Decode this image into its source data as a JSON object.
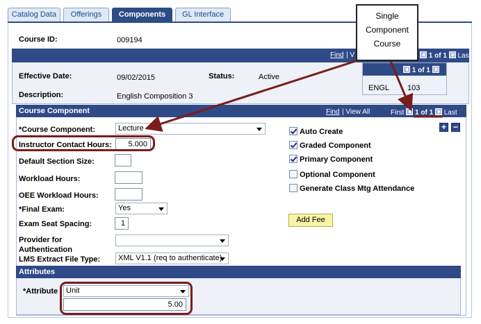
{
  "tabs": [
    {
      "label": "Catalog Data",
      "active": false
    },
    {
      "label": "Offerings",
      "active": false
    },
    {
      "label": "Components",
      "active": true
    },
    {
      "label": "GL Interface",
      "active": false
    }
  ],
  "course": {
    "id_label": "Course ID:",
    "id_value": "009194",
    "nav_find": "Find",
    "nav_view": "V",
    "nav_pos": "1 of 1",
    "nav_last": "Last"
  },
  "effective": {
    "date_label": "Effective Date:",
    "date_value": "09/02/2015",
    "status_label": "Status:",
    "status_value": "Active",
    "description_label": "Description:",
    "description_value": "English Composition 3"
  },
  "mini_grid": {
    "nav_pos": "1 of 1",
    "subject": "ENGL",
    "catalog": "103"
  },
  "component_section": {
    "title": "Course Component",
    "nav_find": "Find",
    "nav_view_all": "View All",
    "nav_first": "First",
    "nav_pos": "1 of 1",
    "nav_last": "Last",
    "add_row": "+",
    "delete_row": "−"
  },
  "fields": {
    "course_component_label": "*Course Component:",
    "course_component_value": "Lecture",
    "contact_hours_label": "Instructor Contact Hours:",
    "contact_hours_value": "5.000",
    "default_section_label": "Default Section Size:",
    "default_section_value": "",
    "workload_label": "Workload Hours:",
    "workload_value": "",
    "oee_workload_label": "OEE Workload Hours:",
    "oee_workload_value": "",
    "final_exam_label": "*Final Exam:",
    "final_exam_value": "Yes",
    "exam_seat_label": "Exam Seat Spacing:",
    "exam_seat_value": "1",
    "provider_label_1": "Provider for",
    "provider_label_2": "Authentication",
    "provider_value": "",
    "lms_label": "LMS Extract File Type:",
    "lms_value": "XML V1.1 (req to authenticate)"
  },
  "checkboxes": [
    {
      "label": "Auto Create",
      "checked": true
    },
    {
      "label": "Graded Component",
      "checked": true
    },
    {
      "label": "Primary Component",
      "checked": true
    },
    {
      "label": "Optional Component",
      "checked": false
    },
    {
      "label": "Generate Class Mtg Attendance",
      "checked": false
    }
  ],
  "add_fee_label": "Add Fee",
  "attributes": {
    "title": "Attributes",
    "attribute_label": "*Attribute",
    "attribute_value": "Unit",
    "attribute_number": "5.00"
  },
  "callout": {
    "line1": "Single",
    "line2": "Component",
    "line3": "Course"
  },
  "colors": {
    "header_blue": "#2f4a87",
    "highlight": "#7a1d1d",
    "fee_button": "#f8f5a8"
  }
}
